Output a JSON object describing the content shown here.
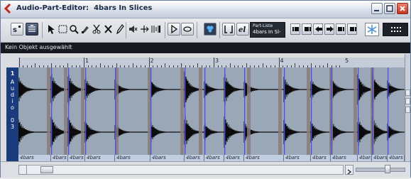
{
  "window": {
    "title": "Audio-Part-Editor:  4bars In Slices"
  },
  "toolbar": {
    "part_list_label": "Part-Liste",
    "part_list_value": "4bars In Sl-",
    "tools": [
      "solo-editor-icon",
      "autoscroll-icon",
      "object-select-icon",
      "range-select-icon",
      "zoom-icon",
      "glue-icon",
      "scissors-icon",
      "erase-icon",
      "draw-icon",
      "mute-icon",
      "scrub-icon",
      "time-warp-icon",
      "play-icon",
      "loop-icon",
      "color-icon",
      "show-part-borders-icon",
      "edit-active-part-icon"
    ]
  },
  "info_line": {
    "text": "Kein Objekt ausgewählt"
  },
  "track": {
    "number": "1",
    "name_letters": [
      "A",
      "u",
      "d",
      "i",
      "o",
      "",
      "0",
      "3"
    ]
  },
  "ruler": {
    "marks": [
      "1",
      "2",
      "3",
      "4",
      "5"
    ]
  },
  "events": {
    "labels": [
      "4bars",
      "4bars",
      "4bars",
      "4bars",
      "4bars",
      "4bars",
      "4bars",
      "4bars",
      "4bars",
      "4bars",
      "4bars",
      "4bars",
      "4bars",
      "4bars",
      "4bars",
      "4bars",
      "4bars"
    ]
  },
  "colors": {
    "event_bg": "#9aa7b6",
    "waveform": "#0b0b0b",
    "slice_marker": "#4d4ef2",
    "track_strip": "#1b3c7c"
  }
}
